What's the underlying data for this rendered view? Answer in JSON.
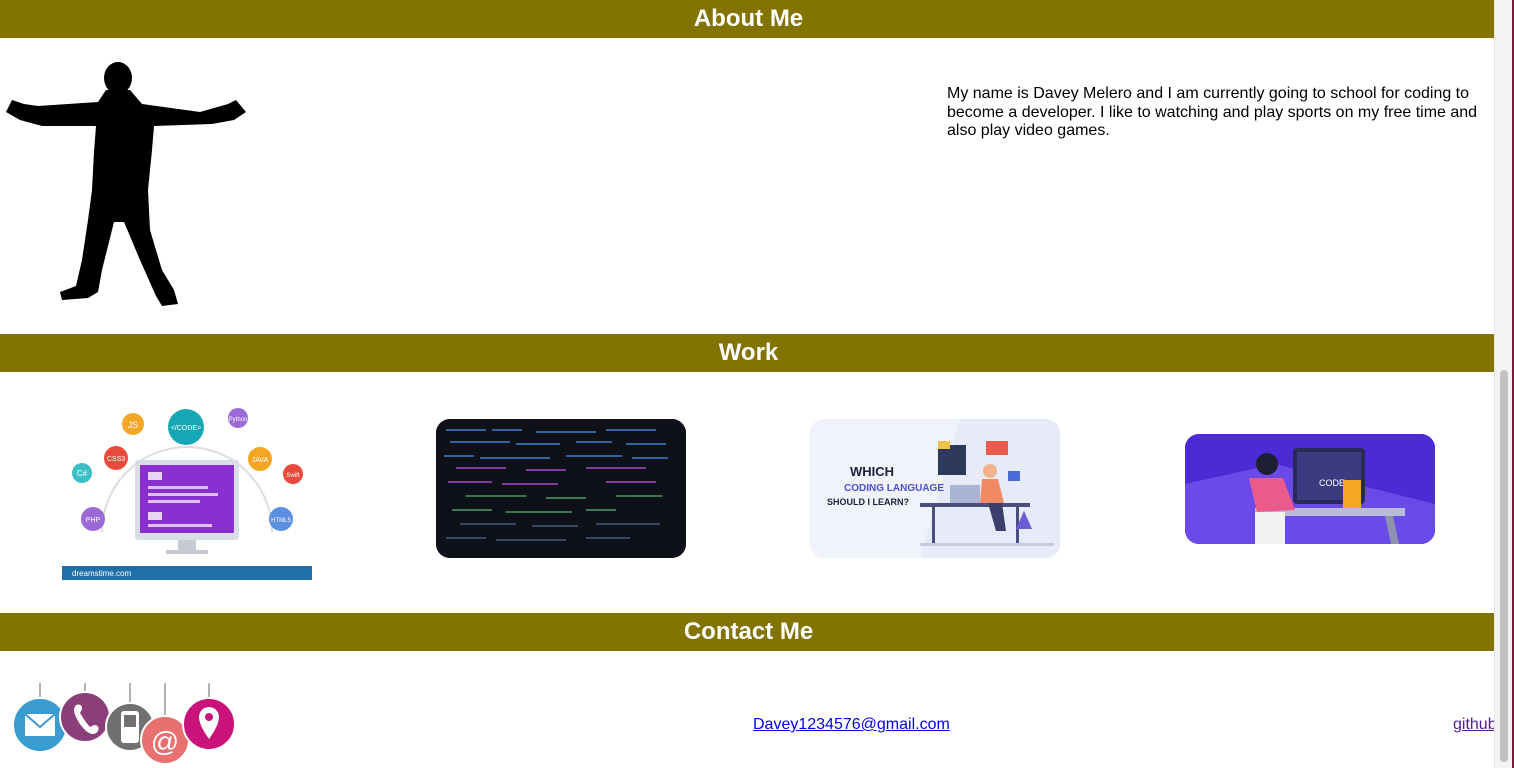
{
  "about": {
    "heading": "About Me",
    "bio": "My name is Davey Melero and I am currently going to school for coding to become a developer. I like to watching and play sports on my free time and also play video games."
  },
  "work": {
    "heading": "Work",
    "cards": [
      {
        "name": "languages-diagram",
        "labels": [
          "JS",
          "</CODE>",
          "Python",
          "C#",
          "CSS3",
          "JAVA",
          "Swift",
          "PHP",
          "HTML5",
          "dreamstime.com"
        ]
      },
      {
        "name": "code-screen"
      },
      {
        "name": "which-language",
        "caption_lines": [
          "WHICH",
          "CODING LANGUAGE",
          "SHOULD I LEARN?"
        ]
      },
      {
        "name": "coder-desk",
        "label": "CODE"
      }
    ]
  },
  "contact": {
    "heading": "Contact Me",
    "email": "Davey1234576@gmail.com",
    "github": "github"
  },
  "colors": {
    "header_bg": "#837300",
    "header_text": "#ffffff",
    "link": "#0000ee",
    "visited_link": "#551a8b"
  },
  "icons": [
    "person-silhouette-icon",
    "mail-icon",
    "phone-icon",
    "mobile-icon",
    "at-sign-icon",
    "location-pin-icon"
  ]
}
